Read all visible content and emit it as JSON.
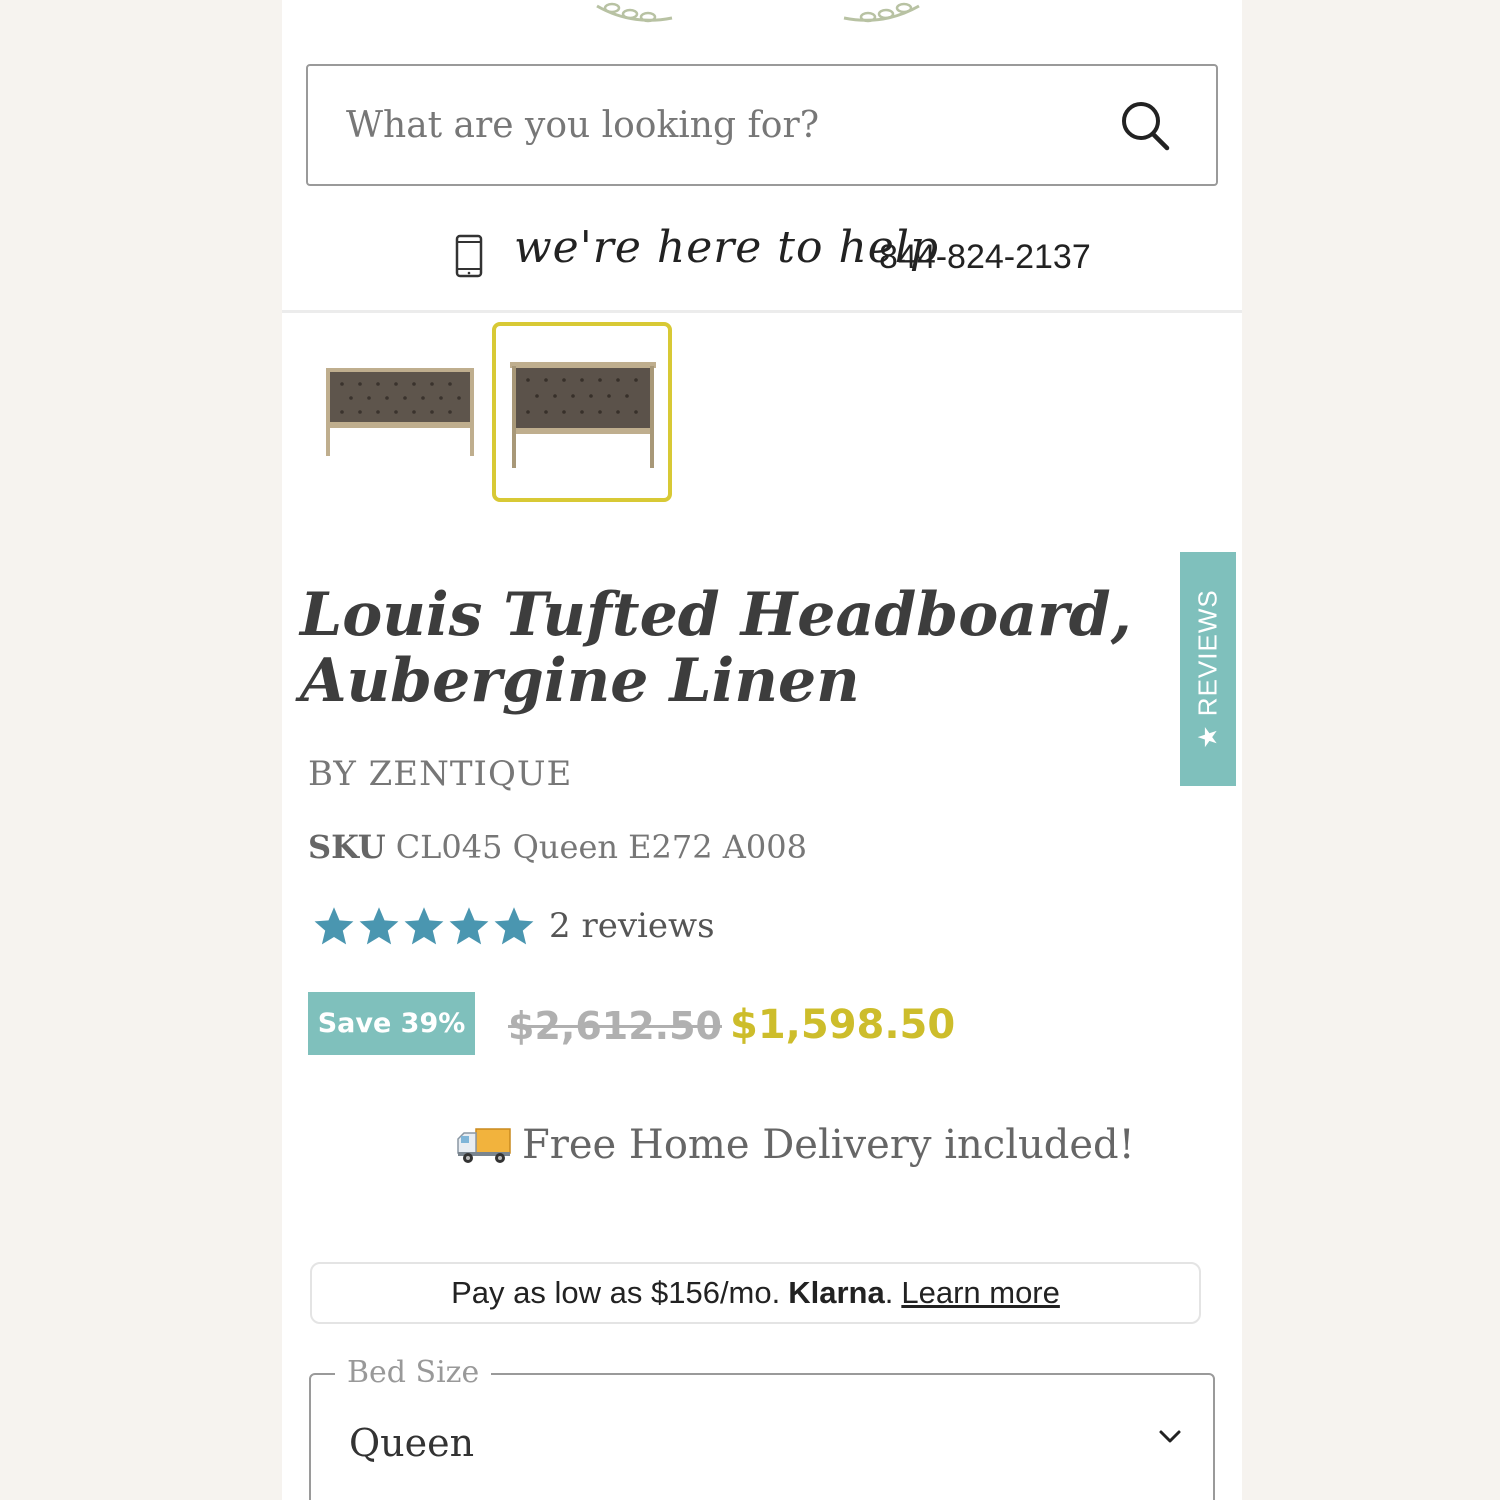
{
  "search": {
    "placeholder": "What are you looking for?"
  },
  "help": {
    "script_text": "we're here to help",
    "phone": "844-824-2137"
  },
  "gallery": {
    "thumbnails": [
      {
        "alt": "Headboard angled view",
        "selected": false
      },
      {
        "alt": "Headboard front view",
        "selected": true
      }
    ]
  },
  "reviews_tab": {
    "label": "★ REVIEWS"
  },
  "product": {
    "title": "Louis Tufted Headboard, Aubergine Linen",
    "brand": "BY ZENTIQUE",
    "sku_label": "SKU",
    "sku_value": "CL045 Queen E272 A008",
    "rating": 5,
    "rating_max": 5,
    "review_count": "2 reviews"
  },
  "pricing": {
    "save_badge": "Save 39%",
    "original_price": "$2,612.50",
    "sale_price": "$1,598.50"
  },
  "delivery": {
    "text": "Free Home Delivery included!"
  },
  "klarna": {
    "text": "Pay as low as $156/mo.",
    "brand": "Klarna",
    "dot": ".",
    "link": "Learn more"
  },
  "bed_size": {
    "legend": "Bed Size",
    "value": "Queen"
  },
  "colors": {
    "accent_teal": "#7fc0bc",
    "star_blue": "#4a96b0",
    "price_yellow": "#cdbd2b",
    "selected_border": "#d8c935"
  },
  "icons": [
    "laurel-icon",
    "search-icon",
    "phone-icon",
    "star-icon",
    "truck-icon",
    "chevron-down-icon"
  ]
}
